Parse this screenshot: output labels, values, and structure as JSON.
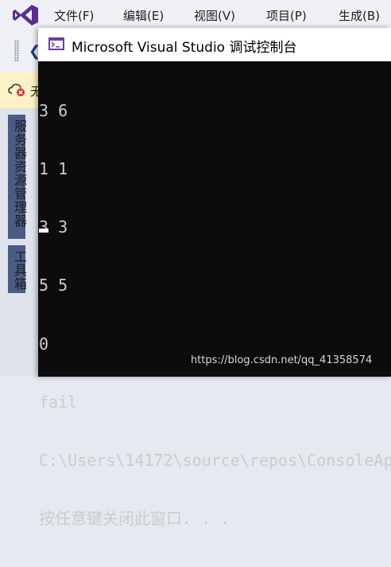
{
  "ide": {
    "menu": [
      "文件(F)",
      "编辑(E)",
      "视图(V)",
      "项目(P)",
      "生成(B)"
    ],
    "notify_text": "无",
    "side_tabs": [
      "服务器资源管理器",
      "工具箱"
    ],
    "logo_color": "#5c2d91"
  },
  "console": {
    "title": "Microsoft Visual Studio 调试控制台",
    "lines": [
      "3 6",
      "1 1",
      "3 3",
      "5 5",
      "0",
      "fail",
      "C:\\Users\\14172\\source\\repos\\ConsoleAp",
      "按任意键关闭此窗口. . ."
    ],
    "background": "#0c0c0c",
    "text_color": "#cccccc"
  },
  "watermark": "https://blog.csdn.net/qq_41358574"
}
